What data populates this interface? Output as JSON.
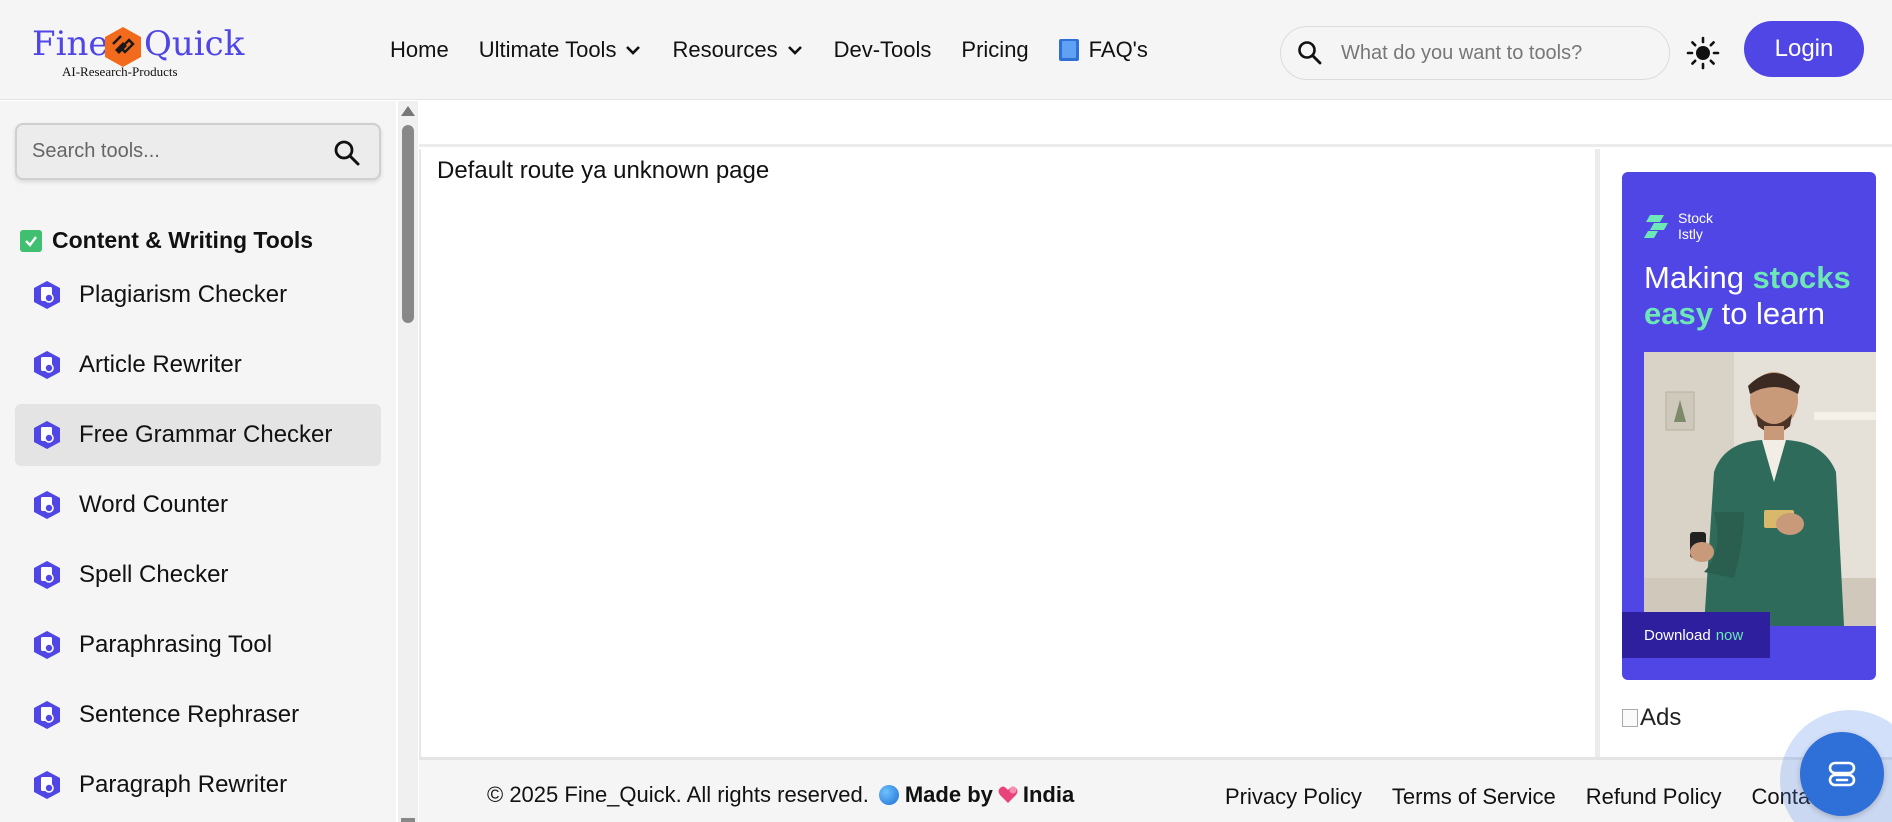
{
  "header": {
    "logo_left": "Fine",
    "logo_right": "Quick",
    "logo_sub": "AI-Research-Products",
    "nav": {
      "home": "Home",
      "ultimate_tools": "Ultimate Tools",
      "resources": "Resources",
      "dev_tools": "Dev-Tools",
      "pricing": "Pricing",
      "faq": "FAQ's"
    },
    "search_placeholder": "What do you want to tools?",
    "login_label": "Login"
  },
  "sidebar": {
    "search_placeholder": "Search tools...",
    "category": "Content & Writing Tools",
    "items": [
      {
        "label": "Plagiarism Checker"
      },
      {
        "label": "Article Rewriter"
      },
      {
        "label": "Free Grammar Checker"
      },
      {
        "label": "Word Counter"
      },
      {
        "label": "Spell Checker"
      },
      {
        "label": "Paraphrasing Tool"
      },
      {
        "label": "Sentence Rephraser"
      },
      {
        "label": "Paragraph Rewriter"
      }
    ],
    "active_item": "Free Grammar Checker"
  },
  "main": {
    "message": "Default route ya unknown page"
  },
  "ad": {
    "brand_line1": "Stock",
    "brand_line2": "Istly",
    "headline_1": "Making ",
    "headline_hl1": "stocks",
    "headline_hl2": "easy",
    "headline_2": " to learn",
    "cta": "Download",
    "cta_hl": "now",
    "alt_text": "Ads"
  },
  "footer": {
    "copyright": "© 2025 Fine_Quick. All rights reserved.",
    "made_by": "Made by",
    "country": "India",
    "links": {
      "privacy": "Privacy Policy",
      "terms": "Terms of Service",
      "refund": "Refund Policy",
      "contact": "Contact Us"
    }
  },
  "colors": {
    "accent": "#4f46e5",
    "ad_highlight": "#6ee7b7",
    "chat_button": "#2f6fd8"
  },
  "icons": [
    "search-icon",
    "chevron-down-icon",
    "book-icon",
    "sun-icon",
    "checkbox-icon",
    "tool-icon",
    "globe-icon",
    "heart-icon",
    "chatbot-icon"
  ]
}
